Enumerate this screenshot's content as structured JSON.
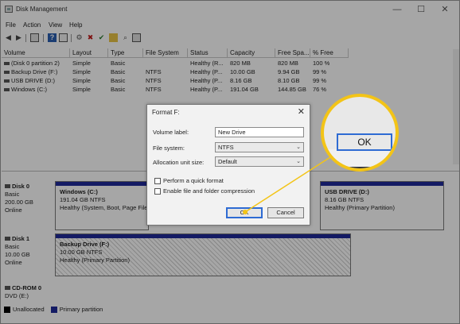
{
  "window": {
    "title": "Disk Management"
  },
  "window_controls": {
    "minimize": "—",
    "maximize": "☐",
    "close": "✕"
  },
  "menu": [
    "File",
    "Action",
    "View",
    "Help"
  ],
  "toolbar_icons": [
    "back-arrow-icon",
    "forward-arrow-icon",
    "console-tree-icon",
    "help-icon",
    "properties-icon",
    "connect-icon",
    "delete-icon",
    "check-icon",
    "open-icon",
    "search-icon",
    "view-icon"
  ],
  "table": {
    "columns": [
      "Volume",
      "Layout",
      "Type",
      "File System",
      "Status",
      "Capacity",
      "Free Spa...",
      "% Free"
    ],
    "rows": [
      [
        "(Disk 0 partition 2)",
        "Simple",
        "Basic",
        "",
        "Healthy (R...",
        "820 MB",
        "820 MB",
        "100 %"
      ],
      [
        "Backup Drive (F:)",
        "Simple",
        "Basic",
        "NTFS",
        "Healthy (P...",
        "10.00 GB",
        "9.94 GB",
        "99 %"
      ],
      [
        "USB DRIVE (D:)",
        "Simple",
        "Basic",
        "NTFS",
        "Healthy (P...",
        "8.16 GB",
        "8.10 GB",
        "99 %"
      ],
      [
        "Windows (C:)",
        "Simple",
        "Basic",
        "NTFS",
        "Healthy (P...",
        "191.04 GB",
        "144.85 GB",
        "76 %"
      ]
    ]
  },
  "disks": {
    "disk0": {
      "name": "Disk 0",
      "type": "Basic",
      "size": "200.00 GB",
      "status": "Online",
      "windows": {
        "name": "Windows  (C:)",
        "size": "191.04 GB NTFS",
        "status": "Healthy (System, Boot, Page File"
      },
      "usb": {
        "name": "USB DRIVE  (D:)",
        "size": "8.16 GB NTFS",
        "status": "Healthy (Primary Partition)"
      }
    },
    "disk1": {
      "name": "Disk 1",
      "type": "Basic",
      "size": "10.00 GB",
      "status": "Online",
      "backup": {
        "name": "Backup Drive  (F:)",
        "size": "10.00 GB NTFS",
        "status": "Healthy (Primary Partition)"
      }
    },
    "cdrom": {
      "name": "CD-ROM 0",
      "type": "DVD (E:)"
    }
  },
  "legend": {
    "unallocated": "Unallocated",
    "primary": "Primary partition"
  },
  "dialog": {
    "title": "Format F:",
    "close": "✕",
    "volume_label": {
      "label": "Volume label:",
      "value": "New Drive"
    },
    "file_system": {
      "label": "File system:",
      "value": "NTFS"
    },
    "allocation": {
      "label": "Allocation unit size:",
      "value": "Default"
    },
    "quick_format": "Perform a quick format",
    "compression": "Enable file and folder compression",
    "ok": "OK",
    "cancel": "Cancel"
  },
  "callout": {
    "zoom_ok": "OK"
  },
  "colors": {
    "primary_partition": "#1f2a9a",
    "unallocated": "#000000",
    "highlight": "#f3c417",
    "focus": "#2e6bd3"
  }
}
